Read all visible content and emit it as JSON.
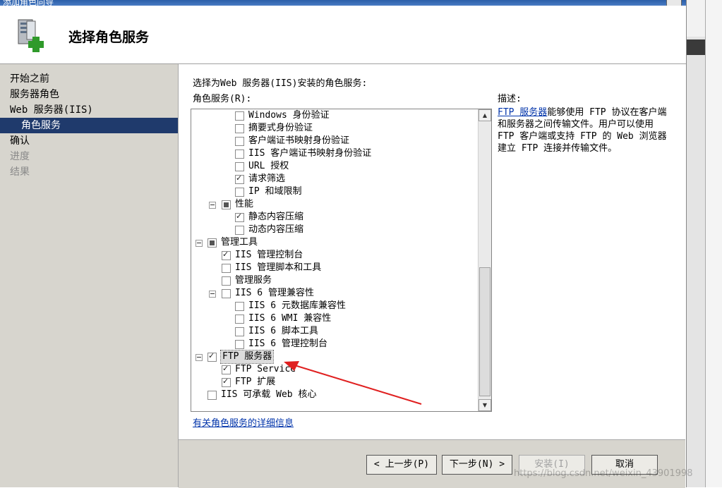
{
  "window": {
    "title": "添加角色向导"
  },
  "header": {
    "title": "选择角色服务",
    "icon": "server-add-icon"
  },
  "nav": {
    "items": [
      {
        "label": "开始之前",
        "state": "normal"
      },
      {
        "label": "服务器角色",
        "state": "normal"
      },
      {
        "label": "Web 服务器(IIS)",
        "state": "normal"
      },
      {
        "label": "角色服务",
        "state": "active"
      },
      {
        "label": "确认",
        "state": "normal"
      },
      {
        "label": "进度",
        "state": "disabled"
      },
      {
        "label": "结果",
        "state": "disabled"
      }
    ]
  },
  "main": {
    "instruction": "选择为Web 服务器(IIS)安装的角色服务:",
    "services_label": "角色服务(R):",
    "more_link": "有关角色服务的详细信息"
  },
  "tree": {
    "items": [
      {
        "label": "Windows 身份验证",
        "level": 2,
        "state": "unchecked",
        "expander": false
      },
      {
        "label": "摘要式身份验证",
        "level": 2,
        "state": "unchecked",
        "expander": false
      },
      {
        "label": "客户端证书映射身份验证",
        "level": 2,
        "state": "unchecked",
        "expander": false
      },
      {
        "label": "IIS 客户端证书映射身份验证",
        "level": 2,
        "state": "unchecked",
        "expander": false
      },
      {
        "label": "URL 授权",
        "level": 2,
        "state": "unchecked",
        "expander": false
      },
      {
        "label": "请求筛选",
        "level": 2,
        "state": "checked",
        "expander": false
      },
      {
        "label": "IP 和域限制",
        "level": 2,
        "state": "unchecked",
        "expander": false
      },
      {
        "label": "性能",
        "level": 1,
        "state": "partial",
        "expander": true
      },
      {
        "label": "静态内容压缩",
        "level": 2,
        "state": "checked",
        "expander": false
      },
      {
        "label": "动态内容压缩",
        "level": 2,
        "state": "unchecked",
        "expander": false
      },
      {
        "label": "管理工具",
        "level": 0,
        "state": "partial",
        "expander": true
      },
      {
        "label": "IIS 管理控制台",
        "level": 1,
        "state": "checked",
        "expander": false
      },
      {
        "label": "IIS 管理脚本和工具",
        "level": 1,
        "state": "unchecked",
        "expander": false
      },
      {
        "label": "管理服务",
        "level": 1,
        "state": "unchecked",
        "expander": false
      },
      {
        "label": "IIS 6 管理兼容性",
        "level": 1,
        "state": "unchecked",
        "expander": true
      },
      {
        "label": "IIS 6 元数据库兼容性",
        "level": 2,
        "state": "unchecked",
        "expander": false
      },
      {
        "label": "IIS 6 WMI 兼容性",
        "level": 2,
        "state": "unchecked",
        "expander": false
      },
      {
        "label": "IIS 6 脚本工具",
        "level": 2,
        "state": "unchecked",
        "expander": false
      },
      {
        "label": "IIS 6 管理控制台",
        "level": 2,
        "state": "unchecked",
        "expander": false
      },
      {
        "label": "FTP 服务器",
        "level": 0,
        "state": "checked",
        "expander": true,
        "selected": true
      },
      {
        "label": "FTP Service",
        "level": 1,
        "state": "checked",
        "expander": false
      },
      {
        "label": "FTP 扩展",
        "level": 1,
        "state": "checked",
        "expander": false
      },
      {
        "label": "IIS 可承载 Web 核心",
        "level": 0,
        "state": "unchecked",
        "expander": false
      }
    ]
  },
  "description": {
    "title": "描述:",
    "link": "FTP 服务器",
    "text": "能够使用 FTP 协议在客户端和服务器之间传输文件。用户可以使用 FTP 客户端或支持 FTP 的 Web 浏览器建立 FTP 连接并传输文件。"
  },
  "buttons": {
    "back": "< 上一步(P)",
    "next": "下一步(N) >",
    "install": "安装(I)",
    "cancel": "取消"
  },
  "watermark": "https://blog.csdn.net/weixin_43901998",
  "colors": {
    "active_nav": "#1f3a6c",
    "link": "#0033aa",
    "arrow": "#e02020",
    "panel": "#d7d5ce"
  }
}
